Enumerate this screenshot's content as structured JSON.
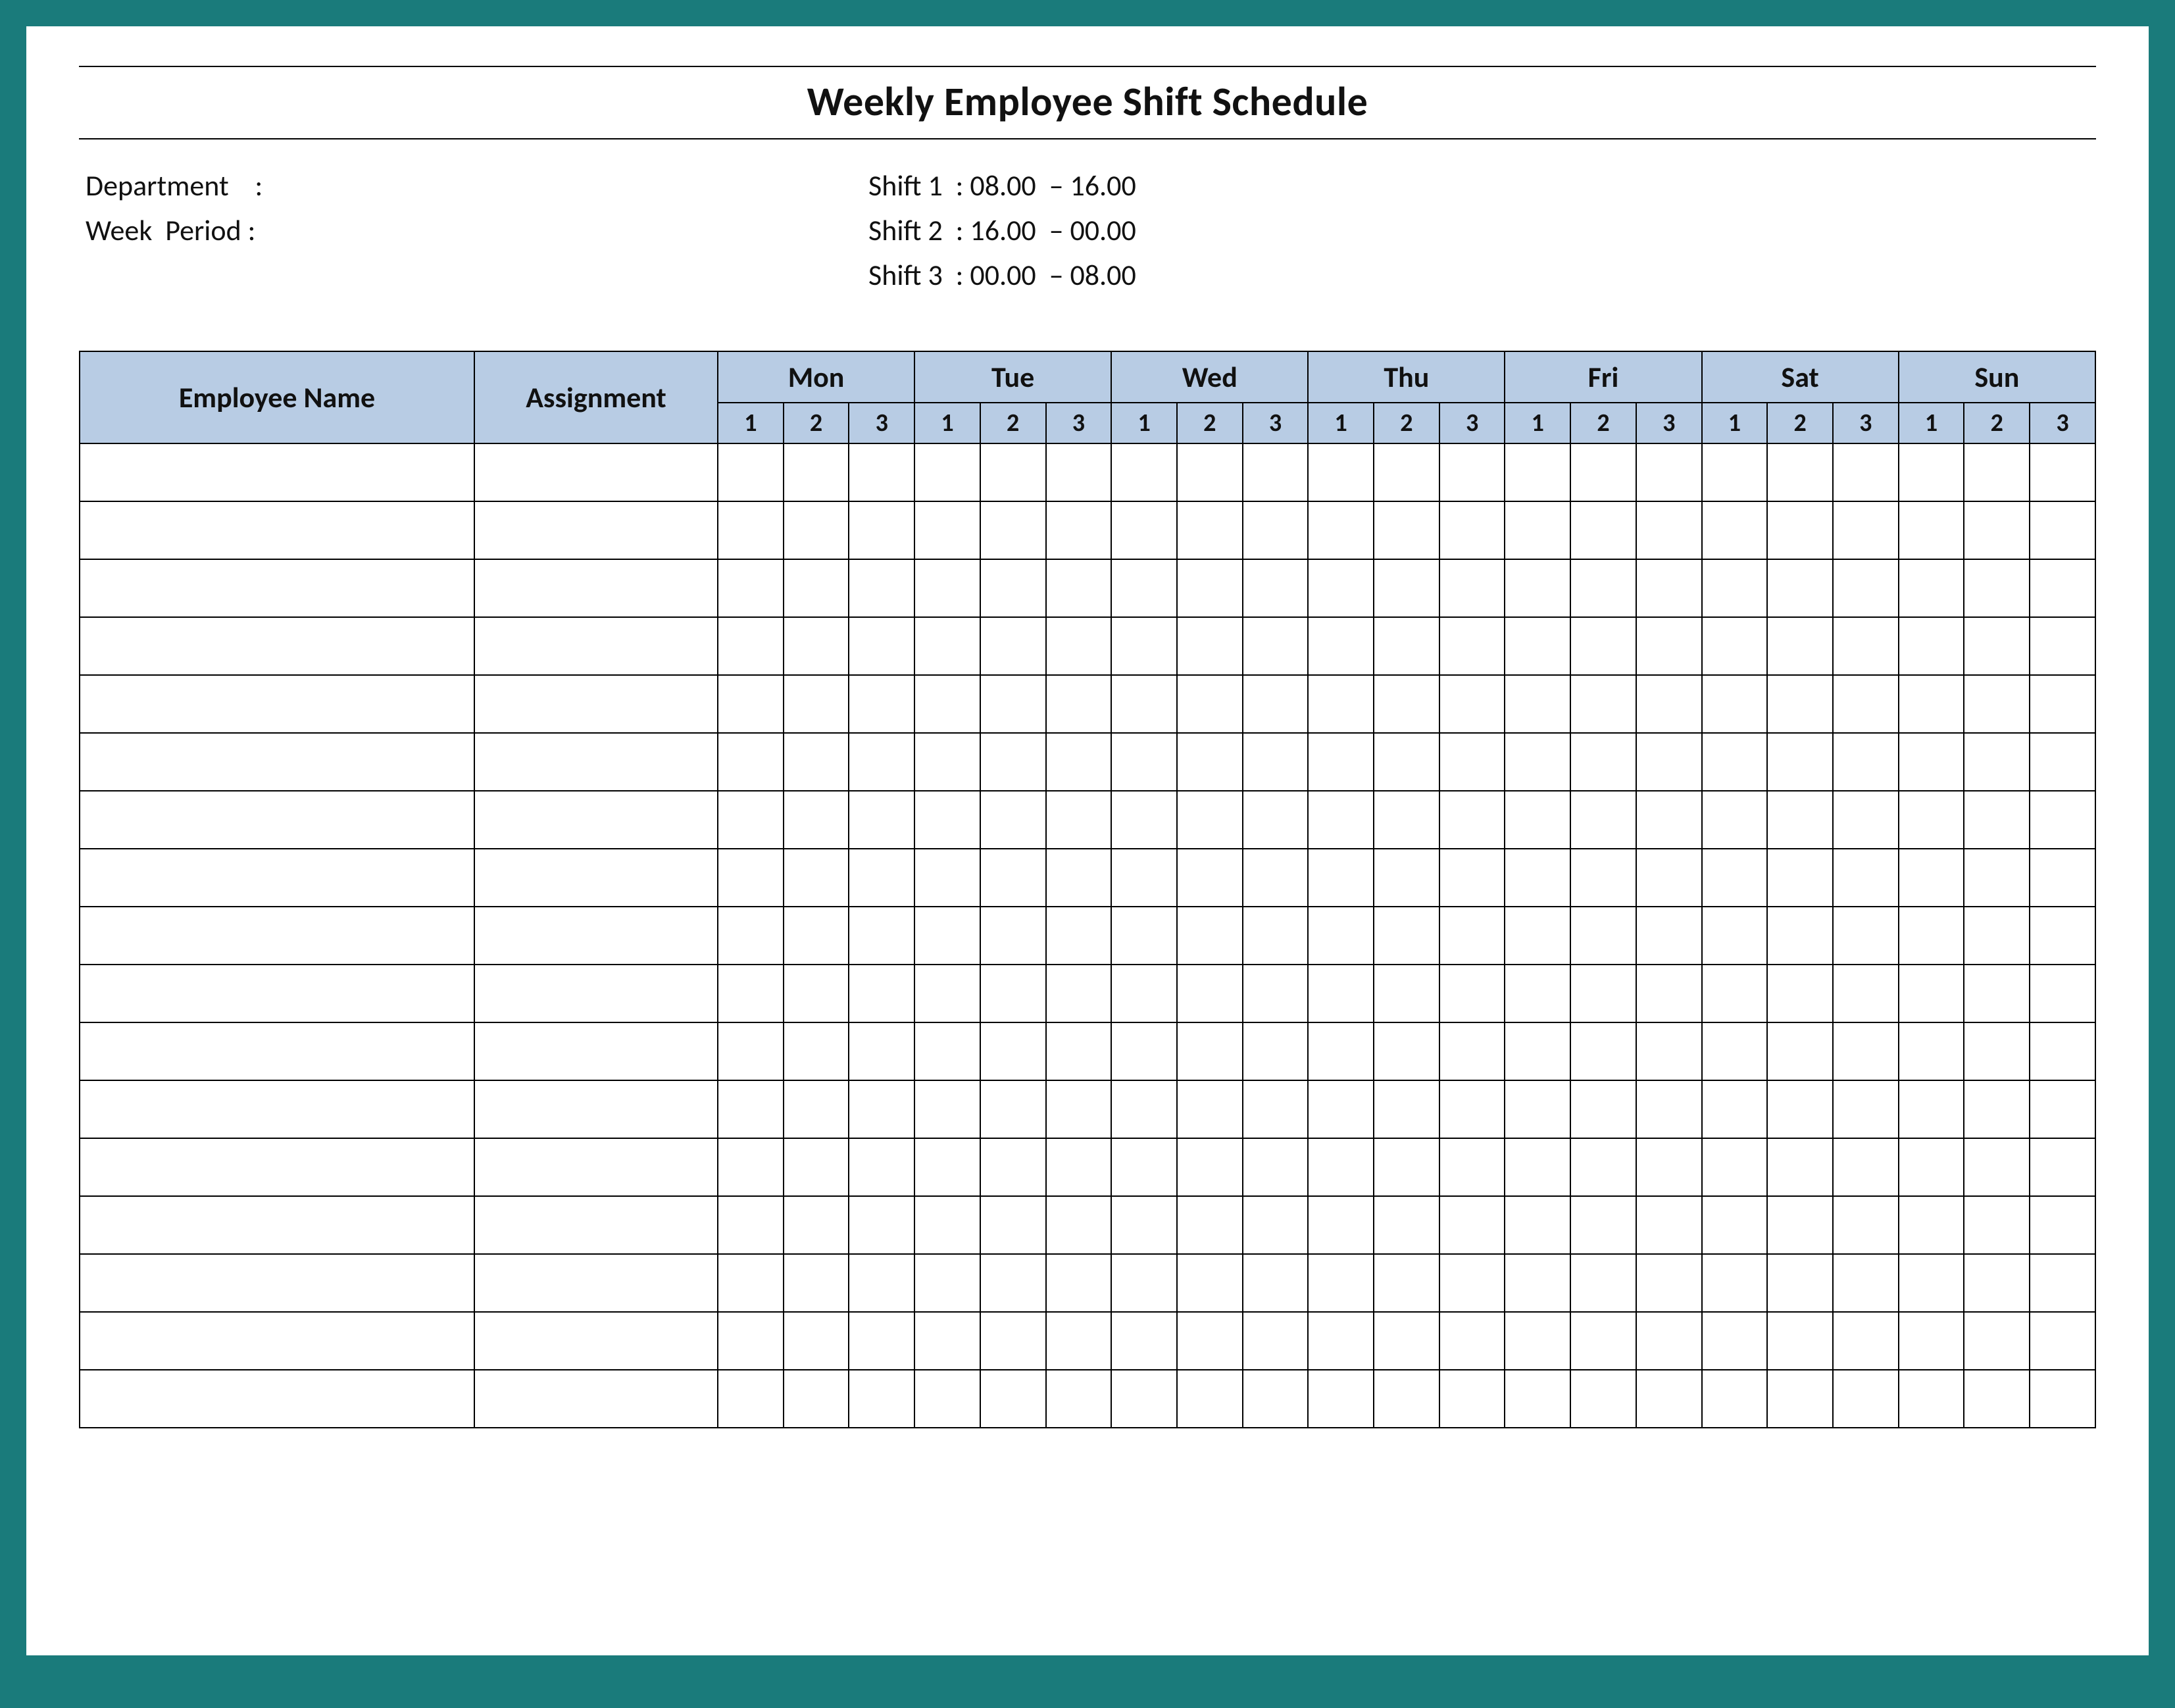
{
  "title": "Weekly Employee Shift Schedule",
  "meta": {
    "department_label": "Department    :",
    "week_period_label": "Week  Period :",
    "shift1": "Shift 1  : 08.00  – 16.00",
    "shift2": "Shift 2  : 16.00  – 00.00",
    "shift3": "Shift 3  : 00.00  – 08.00"
  },
  "headers": {
    "employee_name": "Employee Name",
    "assignment": "Assignment",
    "days": [
      "Mon",
      "Tue",
      "Wed",
      "Thu",
      "Fri",
      "Sat",
      "Sun"
    ],
    "shifts": [
      "1",
      "2",
      "3"
    ]
  },
  "row_count": 17
}
